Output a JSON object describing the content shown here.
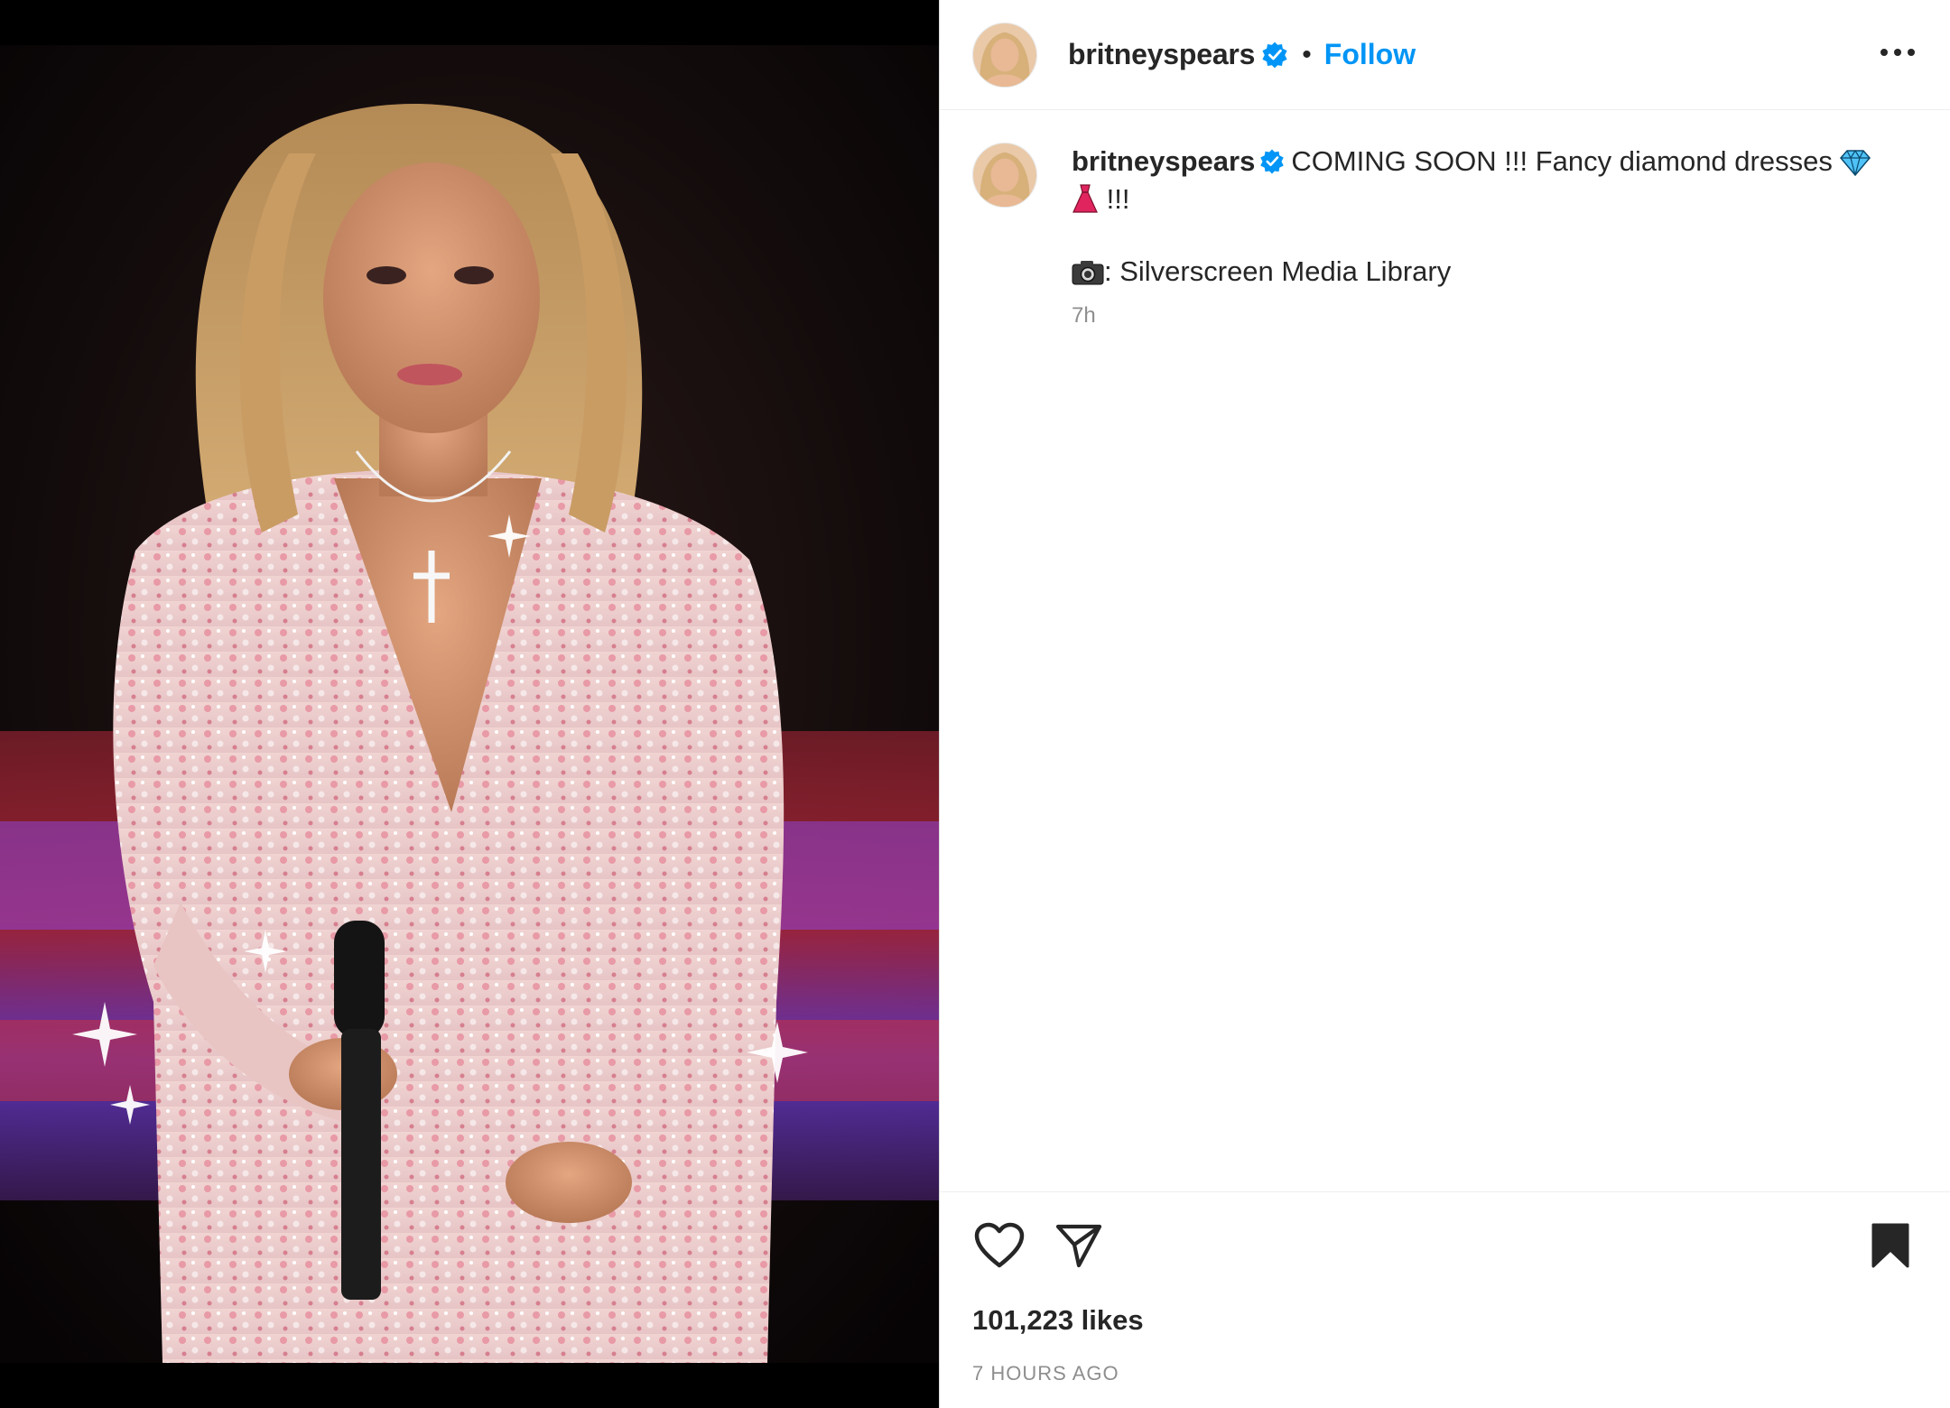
{
  "header": {
    "username": "britneyspears",
    "separator": "•",
    "follow_label": "Follow"
  },
  "caption": {
    "username": "britneyspears",
    "text": "COMING SOON !!! Fancy diamond dresses",
    "text2": "!!!",
    "credit": ": Silverscreen Media Library",
    "timestamp": "7h"
  },
  "footer": {
    "likes": "101,223 likes",
    "posted": "7 HOURS AGO"
  },
  "colors": {
    "accent": "#0095f6",
    "text": "#262626",
    "muted": "#8e8e8e",
    "verified": "#0095f6"
  },
  "icons": {
    "more": "more-horizontal-icon",
    "like": "heart-icon",
    "share": "paper-plane-icon",
    "save": "bookmark-filled-icon",
    "verified": "verified-badge-icon"
  }
}
